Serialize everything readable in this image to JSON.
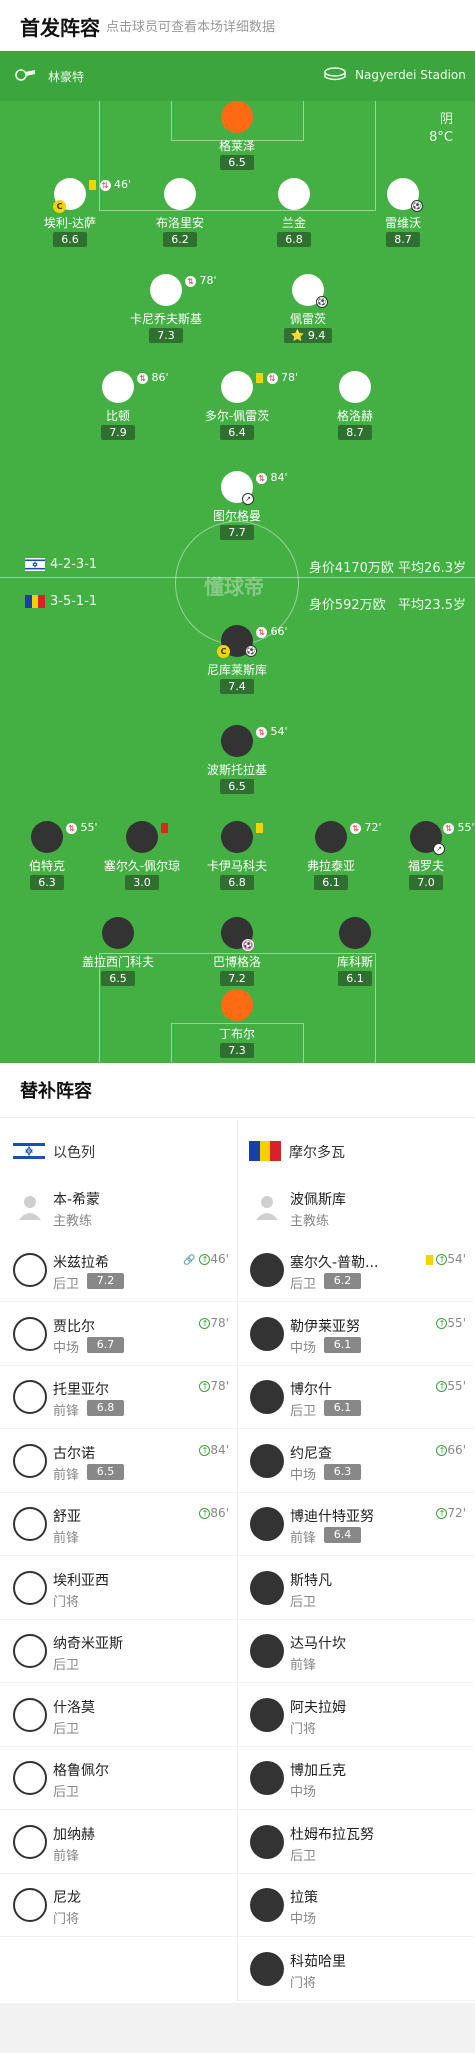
{
  "header": {
    "title": "首发阵容",
    "subtitle": "点击球员可查看本场详细数据"
  },
  "pitch": {
    "home_team": "林豪特",
    "venue": "Nagyerdei Stadion",
    "weather": "阴",
    "temperature": "8°C",
    "logo_text": "懂球帝",
    "home_formation": "4-2-3-1",
    "home_value": "身价4170万欧",
    "home_age": "平均26.3岁",
    "away_formation": "3-5-1-1",
    "away_value": "身价592万欧",
    "away_age": "平均23.5岁"
  },
  "colors": {
    "pitch": "#44b044",
    "home_kit": "#ffffff",
    "away_kit": "#333333",
    "keeper": "#ff6a13"
  },
  "home_players": [
    {
      "name": "格莱泽",
      "rating": "6.5"
    },
    {
      "name": "埃利-达萨",
      "rating": "6.6",
      "event": "46'"
    },
    {
      "name": "布洛里安",
      "rating": "6.2"
    },
    {
      "name": "兰金",
      "rating": "6.8"
    },
    {
      "name": "雷维沃",
      "rating": "8.7"
    },
    {
      "name": "卡尼乔夫斯基",
      "rating": "7.3",
      "event": "78'"
    },
    {
      "name": "佩雷茨",
      "rating": "9.4"
    },
    {
      "name": "比顿",
      "rating": "7.9",
      "event": "86'"
    },
    {
      "name": "多尔-佩雷茨",
      "rating": "6.4",
      "event": "78'"
    },
    {
      "name": "格洛赫",
      "rating": "8.7"
    },
    {
      "name": "图尔格曼",
      "rating": "7.7",
      "event": "84'"
    }
  ],
  "away_players": [
    {
      "name": "尼库莱斯库",
      "rating": "7.4",
      "event": "66'"
    },
    {
      "name": "波斯托拉基",
      "rating": "6.5",
      "event": "54'"
    },
    {
      "name": "伯特克",
      "rating": "6.3",
      "event": "55'"
    },
    {
      "name": "塞尔久-佩尔琼",
      "rating": "3.0"
    },
    {
      "name": "卡伊马科夫",
      "rating": "6.8"
    },
    {
      "name": "弗拉泰亚",
      "rating": "6.1",
      "event": "72'"
    },
    {
      "name": "福罗夫",
      "rating": "7.0",
      "event": "55'"
    },
    {
      "name": "盖拉西门科夫",
      "rating": "6.5"
    },
    {
      "name": "巴博格洛",
      "rating": "7.2"
    },
    {
      "name": "库科斯",
      "rating": "6.1"
    },
    {
      "name": "丁布尔",
      "rating": "7.3"
    }
  ],
  "subs": {
    "title": "替补阵容",
    "home": {
      "team": "以色列",
      "coach": "本-希蒙",
      "coach_role": "主教练",
      "players": [
        {
          "name": "米兹拉希",
          "pos": "后卫",
          "rating": "7.2",
          "minute": "46'"
        },
        {
          "name": "贾比尔",
          "pos": "中场",
          "rating": "6.7",
          "minute": "78'"
        },
        {
          "name": "托里亚尔",
          "pos": "前锋",
          "rating": "6.8",
          "minute": "78'"
        },
        {
          "name": "古尔诺",
          "pos": "前锋",
          "rating": "6.5",
          "minute": "84'"
        },
        {
          "name": "舒亚",
          "pos": "前锋",
          "rating": "",
          "minute": "86'"
        },
        {
          "name": "埃利亚西",
          "pos": "门将",
          "rating": "",
          "minute": ""
        },
        {
          "name": "纳奇米亚斯",
          "pos": "后卫",
          "rating": "",
          "minute": ""
        },
        {
          "name": "什洛莫",
          "pos": "后卫",
          "rating": "",
          "minute": ""
        },
        {
          "name": "格鲁佩尔",
          "pos": "后卫",
          "rating": "",
          "minute": ""
        },
        {
          "name": "加纳赫",
          "pos": "前锋",
          "rating": "",
          "minute": ""
        },
        {
          "name": "尼龙",
          "pos": "门将",
          "rating": "",
          "minute": ""
        }
      ]
    },
    "away": {
      "team": "摩尔多瓦",
      "coach": "波佩斯库",
      "coach_role": "主教练",
      "players": [
        {
          "name": "塞尔久-普勒...",
          "pos": "后卫",
          "rating": "6.2",
          "minute": "54'"
        },
        {
          "name": "勒伊莱亚努",
          "pos": "中场",
          "rating": "6.1",
          "minute": "55'"
        },
        {
          "name": "博尔什",
          "pos": "后卫",
          "rating": "6.1",
          "minute": "55'"
        },
        {
          "name": "约尼查",
          "pos": "中场",
          "rating": "6.3",
          "minute": "66'"
        },
        {
          "name": "博迪什特亚努",
          "pos": "前锋",
          "rating": "6.4",
          "minute": "72'"
        },
        {
          "name": "斯特凡",
          "pos": "后卫",
          "rating": "",
          "minute": ""
        },
        {
          "name": "达马什坎",
          "pos": "前锋",
          "rating": "",
          "minute": ""
        },
        {
          "name": "阿夫拉姆",
          "pos": "门将",
          "rating": "",
          "minute": ""
        },
        {
          "name": "博加丘克",
          "pos": "中场",
          "rating": "",
          "minute": ""
        },
        {
          "name": "杜姆布拉瓦努",
          "pos": "后卫",
          "rating": "",
          "minute": ""
        },
        {
          "name": "拉策",
          "pos": "中场",
          "rating": "",
          "minute": ""
        },
        {
          "name": "科茹哈里",
          "pos": "门将",
          "rating": "",
          "minute": ""
        }
      ]
    }
  }
}
